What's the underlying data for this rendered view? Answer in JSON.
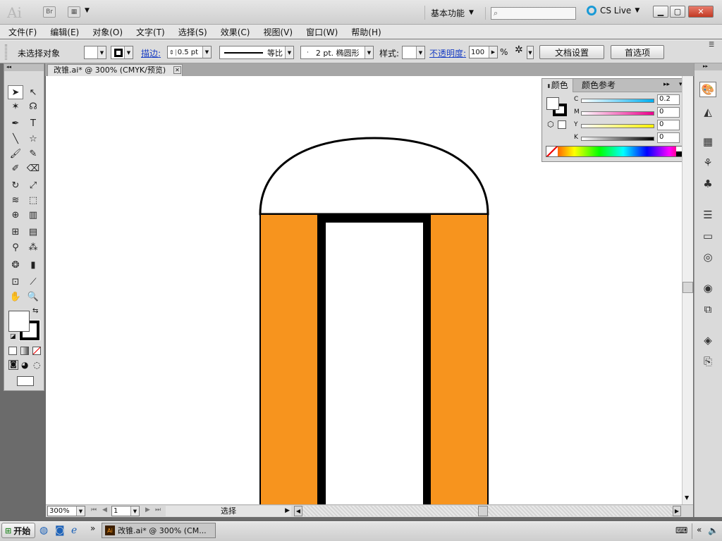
{
  "titlebar": {
    "app_logo": "Ai",
    "bridge_label": "Br",
    "workspace": "基本功能",
    "search_placeholder": "",
    "cs_live": "CS Live"
  },
  "menu": [
    "文件(F)",
    "编辑(E)",
    "对象(O)",
    "文字(T)",
    "选择(S)",
    "效果(C)",
    "视图(V)",
    "窗口(W)",
    "帮助(H)"
  ],
  "control": {
    "selection_status": "未选择对象",
    "stroke_label": "描边:",
    "stroke_weight": "0.5 pt",
    "line_profile": "等比",
    "brush": "2 pt. 椭圆形",
    "style_label": "样式:",
    "opacity_label": "不透明度:",
    "opacity_value": "100",
    "opacity_unit": "%",
    "doc_setup_button": "文档设置",
    "preferences_button": "首选项"
  },
  "document_tab": {
    "title": "改锥.ai* @ 300% (CMYK/预览)"
  },
  "color_panel": {
    "tab_color": "颜色",
    "tab_guide": "颜色参考",
    "channels": [
      {
        "label": "C",
        "value": "0.2"
      },
      {
        "label": "M",
        "value": "0"
      },
      {
        "label": "Y",
        "value": "0"
      },
      {
        "label": "K",
        "value": "0"
      }
    ],
    "unit": "%"
  },
  "statusbar": {
    "zoom": "300%",
    "page": "1",
    "mode": "选择"
  },
  "taskbar": {
    "start": "开始",
    "task_label": "改锥.ai* @ 300% (CM..."
  },
  "colors": {
    "orange_fill": "#F7941E",
    "black": "#000000",
    "cs_live_blue": "#1a9ad6"
  }
}
